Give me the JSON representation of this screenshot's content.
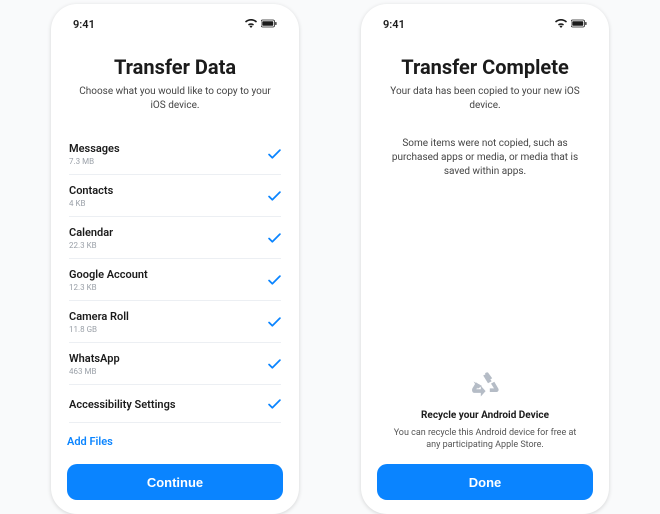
{
  "status": {
    "time": "9:41"
  },
  "left": {
    "title": "Transfer Data",
    "subtitle": "Choose what you would like to copy to your iOS device.",
    "items": [
      {
        "label": "Messages",
        "size": "7.3 MB"
      },
      {
        "label": "Contacts",
        "size": "4 KB"
      },
      {
        "label": "Calendar",
        "size": "22.3 KB"
      },
      {
        "label": "Google Account",
        "size": "12.3 KB"
      },
      {
        "label": "Camera Roll",
        "size": "11.8 GB"
      },
      {
        "label": "WhatsApp",
        "size": "463 MB"
      },
      {
        "label": "Accessibility Settings",
        "size": ""
      }
    ],
    "add_files": "Add Files",
    "continue_label": "Continue"
  },
  "right": {
    "title": "Transfer Complete",
    "subtitle": "Your data has been copied to your new iOS device.",
    "note": "Some items were not copied, such as purchased apps or media, or media that is saved within apps.",
    "recycle_title": "Recycle your Android Device",
    "recycle_text": "You can recycle this Android device for free at any participating Apple Store.",
    "done_label": "Done"
  },
  "colors": {
    "accent": "#0a84ff"
  }
}
